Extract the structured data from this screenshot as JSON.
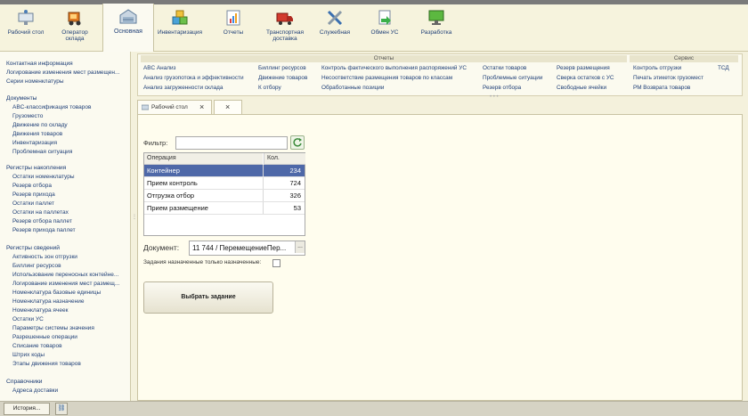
{
  "sections": [
    {
      "label": "Рабочий стол",
      "icon": "desktop-icon"
    },
    {
      "label": "Оператор склада",
      "icon": "forklift-icon"
    },
    {
      "label": "Основная",
      "icon": "warehouse-icon",
      "active": true
    },
    {
      "label": "Инвентаризация",
      "icon": "boxes-icon"
    },
    {
      "label": "Отчеты",
      "icon": "chart-icon"
    },
    {
      "label": "Транспортная доставка",
      "icon": "truck-icon"
    },
    {
      "label": "Служебная",
      "icon": "tools-icon"
    },
    {
      "label": "Обмен УС",
      "icon": "exchange-icon"
    },
    {
      "label": "Разработка",
      "icon": "monitor-icon"
    }
  ],
  "left_panel": {
    "top_items": [
      "Контактная информация",
      "Логирование изменения мест размещен...",
      "Серии номенклатуры"
    ],
    "documents": {
      "header": "Документы",
      "items": [
        "ABC-классификация товаров",
        "Грузоместо",
        "Движение по складу",
        "Движения товаров",
        "Инвентаризация",
        "Проблемная ситуация"
      ]
    },
    "registers_accum": {
      "header": "Регистры накопления",
      "items": [
        "Остатки номенклатуры",
        "Резерв отбора",
        "Резерв прихода",
        "Остатки паллет",
        "Остатки на паллетах",
        "Резерв отбора паллет",
        "Резерв прихода паллет"
      ]
    },
    "registers_info": {
      "header": "Регистры сведений",
      "items": [
        "Активность зон отгрузки",
        "Биллинг ресурсов",
        "Использование переносных контейне...",
        "Логирование изменения мест размещ...",
        "Номенклатура базовые единицы",
        "Номенклатура назначение",
        "Номенклатура ячеек",
        "Остатки УС",
        "Параметры системы значения",
        "Разрешенные операции",
        "Списание товаров",
        "Штрих коды",
        "Этапы движения товаров"
      ]
    },
    "references": {
      "header": "Справочники",
      "items": [
        "Адреса доставки"
      ]
    }
  },
  "actions": {
    "reports_header": "Отчеты",
    "service_header": "Сервис",
    "col1": [
      "ABC Анализ",
      "Анализ грузопотока и эффективности",
      "Анализ загруженности склада"
    ],
    "col2": [
      "Биллинг ресурсов",
      "Движение товаров",
      "К отбору"
    ],
    "col3": [
      "Контроль фактического выполнения распоряжений УС",
      "Несоответствие размещения товаров по классам",
      "Обработанные позиции"
    ],
    "col4": [
      "Остатки товаров",
      "Проблемные ситуации",
      "Резерв отбора"
    ],
    "col5": [
      "Резерв размещения",
      "Сверка остатков с УС",
      "Свободные ячейки"
    ],
    "service_col": [
      "Контроль отгрузки",
      "Печать этикеток грузомест",
      "РМ Возврата товаров"
    ],
    "tsd": "ТСД"
  },
  "tabs": [
    {
      "label": "Рабочий стол"
    },
    {
      "label": ""
    }
  ],
  "form": {
    "filter_label": "Фильтр:",
    "filter_value": "",
    "grid_headers": {
      "operation": "Операция",
      "qty": "Кол."
    },
    "rows": [
      {
        "op": "Контейнер",
        "qty": "234"
      },
      {
        "op": "Прием контроль",
        "qty": "724"
      },
      {
        "op": "Отгрузка отбор",
        "qty": "326"
      },
      {
        "op": "Прием размещение",
        "qty": "53"
      }
    ],
    "doc_label": "Документ:",
    "doc_value": "11 744 / ПеремещениеПер...",
    "doc_btn": "...",
    "only_assigned_label": "Задания назначенные только назначенные:",
    "select_task": "Выбрать задание"
  },
  "bottom": {
    "history": "История..."
  }
}
